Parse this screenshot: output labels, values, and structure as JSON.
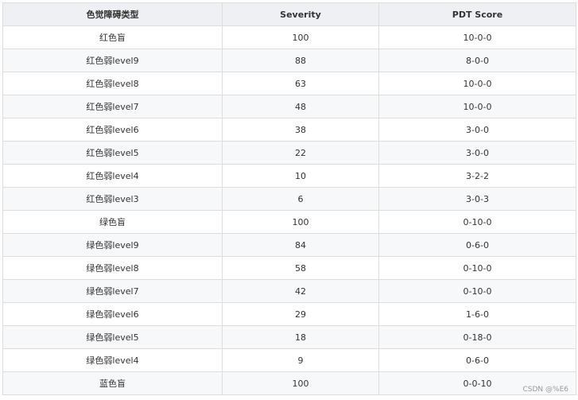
{
  "table": {
    "headers": [
      "色觉障碍类型",
      "Severity",
      "PDT Score"
    ],
    "rows": [
      [
        "红色盲",
        "100",
        "10-0-0"
      ],
      [
        "红色弱level9",
        "88",
        "8-0-0"
      ],
      [
        "红色弱level8",
        "63",
        "10-0-0"
      ],
      [
        "红色弱level7",
        "48",
        "10-0-0"
      ],
      [
        "红色弱level6",
        "38",
        "3-0-0"
      ],
      [
        "红色弱level5",
        "22",
        "3-0-0"
      ],
      [
        "红色弱level4",
        "10",
        "3-2-2"
      ],
      [
        "红色弱level3",
        "6",
        "3-0-3"
      ],
      [
        "绿色盲",
        "100",
        "0-10-0"
      ],
      [
        "绿色弱level9",
        "84",
        "0-6-0"
      ],
      [
        "绿色弱level8",
        "58",
        "0-10-0"
      ],
      [
        "绿色弱level7",
        "42",
        "0-10-0"
      ],
      [
        "绿色弱level6",
        "29",
        "1-6-0"
      ],
      [
        "绿色弱level5",
        "18",
        "0-18-0"
      ],
      [
        "绿色弱level4",
        "9",
        "0-6-0"
      ],
      [
        "蓝色盲",
        "100",
        "0-0-10"
      ]
    ]
  },
  "watermark": "CSDN @%E6"
}
